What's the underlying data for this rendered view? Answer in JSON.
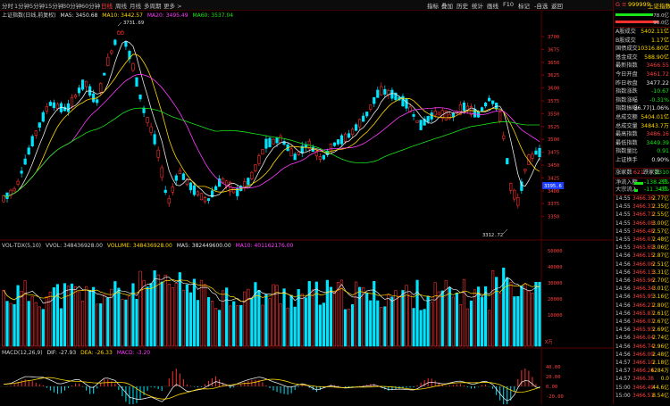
{
  "toolbar": {
    "timeframes": [
      "分时",
      "1分钟",
      "5分钟",
      "15分钟",
      "30分钟",
      "60分钟",
      "日线",
      "周线",
      "月线",
      "多周期",
      "更多 >"
    ],
    "active_timeframe": "日线",
    "menu": [
      "指标",
      "叠加",
      "历史",
      "统计",
      "画线",
      "F10",
      "标记",
      "-自选",
      "返回"
    ]
  },
  "main_chart": {
    "symbol_label": "上证指数(日线,前复权)",
    "ma5": "MA5: 3450.68",
    "ma10": "MA10: 3442.57",
    "ma20": "MA20: 3495.49",
    "ma60": "MA60: 3537.04",
    "high_marker": "3731.69",
    "low_marker": "3312.72",
    "current_price_tag": "3395.6",
    "y_ticks": [
      "3700",
      "3675",
      "3650",
      "3625",
      "3600",
      "3575",
      "3550",
      "3525",
      "3500",
      "3475",
      "3450",
      "3425",
      "3400",
      "3375",
      "3350"
    ]
  },
  "volume_chart": {
    "label": "VOL-TDX(5,10)",
    "vvol": "VVOL: 348436928.00",
    "volume": "VOLUME: 348436928.00",
    "ma5": "MA5: 382449600.00",
    "ma10": "MA10: 401162176.00",
    "y_ticks": [
      "50000",
      "40000",
      "30000",
      "20000",
      "10000"
    ],
    "unit": "X万"
  },
  "macd_chart": {
    "label": "MACD(12,26,9)",
    "dif": "DIF: -27.93",
    "dea": "DEA: -26.33",
    "macd": "MACD: -3.20",
    "y_ticks": [
      "40.00",
      "20.00",
      "0.00",
      "-20.00"
    ]
  },
  "chart_data": [
    {
      "type": "candlestick",
      "title": "上证指数(日线,前复权)",
      "ylim": [
        3312.72,
        3731.69
      ],
      "series": [
        {
          "name": "MA5",
          "last": 3450.68
        },
        {
          "name": "MA10",
          "last": 3442.57
        },
        {
          "name": "MA20",
          "last": 3495.49
        },
        {
          "name": "MA60",
          "last": 3537.04
        }
      ],
      "annotations": {
        "high": 3731.69,
        "low": 3312.72
      }
    },
    {
      "type": "bar",
      "title": "VOL-TDX(5,10)",
      "ylim": [
        0,
        50000
      ]
    },
    {
      "type": "bar",
      "title": "MACD(12,26,9)",
      "series": [
        {
          "name": "DIF",
          "last": -27.93
        },
        {
          "name": "DEA",
          "last": -26.33
        },
        {
          "name": "MACD",
          "last": -3.2
        }
      ]
    }
  ],
  "quote_panel": {
    "code": "999999",
    "name": "上证指数",
    "bar1_value": "78.0亿",
    "bar2_value": "90.0亿",
    "rows": [
      {
        "label": "A股成交",
        "value": "5402.11亿",
        "color": "yel"
      },
      {
        "label": "B股成交",
        "value": "1.17亿",
        "color": "yel"
      },
      {
        "label": "国债成交",
        "value": "10316.80亿",
        "color": "yel"
      },
      {
        "label": "基金成交",
        "value": "588.90亿",
        "color": "yel"
      },
      {
        "label": "最新指数",
        "value": "3466.55",
        "color": "red"
      },
      {
        "label": "今日开盘",
        "value": "3461.72",
        "color": "red"
      },
      {
        "label": "昨日收盘",
        "value": "3477.22",
        "color": "wht"
      },
      {
        "label": "指数涨跌",
        "value": "-10.67",
        "color": "grn"
      },
      {
        "label": "指数涨幅",
        "value": "-0.31%",
        "color": "grn"
      },
      {
        "label": "指数振幅",
        "value": "36.77|1.06%",
        "color": "wht"
      },
      {
        "label": "总成交额",
        "value": "5404.01亿",
        "color": "yel"
      },
      {
        "label": "总成交量",
        "value": "34843.7万",
        "color": "yel"
      },
      {
        "label": "最高指数",
        "value": "3486.16",
        "color": "red"
      },
      {
        "label": "最低指数",
        "value": "3449.39",
        "color": "grn"
      },
      {
        "label": "指数量比",
        "value": "0.91",
        "color": "grn"
      },
      {
        "label": "上证换手",
        "value": "0.90%",
        "color": "wht"
      }
    ],
    "rise_label": "涨家数",
    "rise_value": "621",
    "fall_label": "跌家数",
    "fall_value": "1310",
    "inflow_label": "净流入额",
    "inflow_value": "-138.2亿",
    "inflow_pct": "-3%",
    "big_label": "大宗流入",
    "big_value": "-11.34亿",
    "big_pct": "-0%",
    "ticks": [
      {
        "time": "14:55",
        "price": "3466.36",
        "amount": "2.77亿"
      },
      {
        "time": "14:55",
        "price": "3466.31",
        "amount": "2.35亿"
      },
      {
        "time": "14:55",
        "price": "3466.71",
        "amount": "2.55亿"
      },
      {
        "time": "14:55",
        "price": "3466.08",
        "amount": "3.00亿"
      },
      {
        "time": "14:55",
        "price": "3466.48",
        "amount": "2.57亿"
      },
      {
        "time": "14:55",
        "price": "3466.07",
        "amount": "2.48亿"
      },
      {
        "time": "14:55",
        "price": "3465.69",
        "amount": "3.06亿"
      },
      {
        "time": "14:56",
        "price": "3466.15",
        "amount": "2.87亿"
      },
      {
        "time": "14:56",
        "price": "3466.06",
        "amount": "2.51亿"
      },
      {
        "time": "14:56",
        "price": "3466.13",
        "amount": "3.31亿"
      },
      {
        "time": "14:56",
        "price": "3465.96",
        "amount": "2.70亿"
      },
      {
        "time": "14:56",
        "price": "3466.34",
        "amount": "3.01亿"
      },
      {
        "time": "14:56",
        "price": "3465.95",
        "amount": "3.16亿"
      },
      {
        "time": "14:56",
        "price": "3466.21",
        "amount": "2.80亿"
      },
      {
        "time": "14:56",
        "price": "3465.87",
        "amount": "2.61亿"
      },
      {
        "time": "14:56",
        "price": "3466.07",
        "amount": "2.67亿"
      },
      {
        "time": "14:56",
        "price": "3465.93",
        "amount": "2.69亿"
      },
      {
        "time": "14:56",
        "price": "3466.04",
        "amount": "2.74亿"
      },
      {
        "time": "14:56",
        "price": "3466.74",
        "amount": "2.96亿"
      },
      {
        "time": "14:56",
        "price": "3466.09",
        "amount": "2.48亿"
      },
      {
        "time": "14:57",
        "price": "3466.10",
        "amount": "2.18亿"
      },
      {
        "time": "14:57",
        "price": "3466.24",
        "amount": "6284万"
      },
      {
        "time": "14:57",
        "price": "3466.38",
        "amount": "0.0"
      },
      {
        "time": "15:00",
        "price": "3466.49",
        "amount": "44.6亿"
      },
      {
        "time": "15:00",
        "price": "3466.51",
        "amount": "8.54亿"
      }
    ]
  }
}
